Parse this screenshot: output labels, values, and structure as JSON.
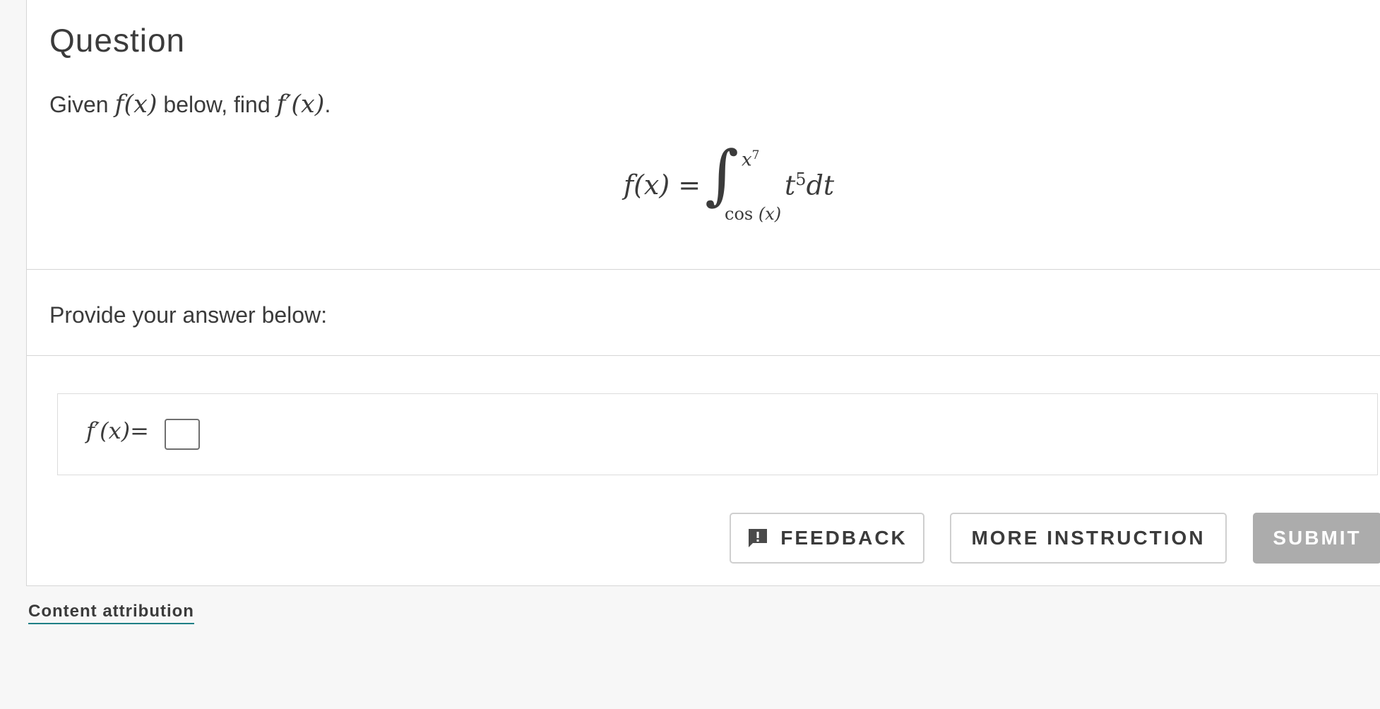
{
  "question": {
    "heading": "Question",
    "prompt": {
      "lead": "Given",
      "fx": "f(x)",
      "middle": "below, find",
      "fpx": "f′(x)",
      "end": "."
    },
    "equation": {
      "lhs": "f(x)",
      "equals": "=",
      "integral_sign": "∫",
      "upper_base": "x",
      "upper_exp": "7",
      "lower_func": "cos",
      "lower_arg": "(x)",
      "integrand_base": "t",
      "integrand_exp": "5",
      "differential": "dt"
    }
  },
  "answer": {
    "instruction": "Provide your answer below:",
    "label": "f′(x)",
    "equals": "=",
    "input_value": ""
  },
  "buttons": {
    "feedback": "FEEDBACK",
    "more_instruction": "MORE INSTRUCTION",
    "submit": "SUBMIT"
  },
  "footer": {
    "attribution": "Content attribution"
  },
  "colors": {
    "text": "#3b3b3b",
    "submit_bg": "#acacac",
    "attribution_underline": "#1e7f86",
    "page_bg": "#f7f7f7"
  },
  "icons": {
    "feedback": "feedback-alert-icon"
  }
}
